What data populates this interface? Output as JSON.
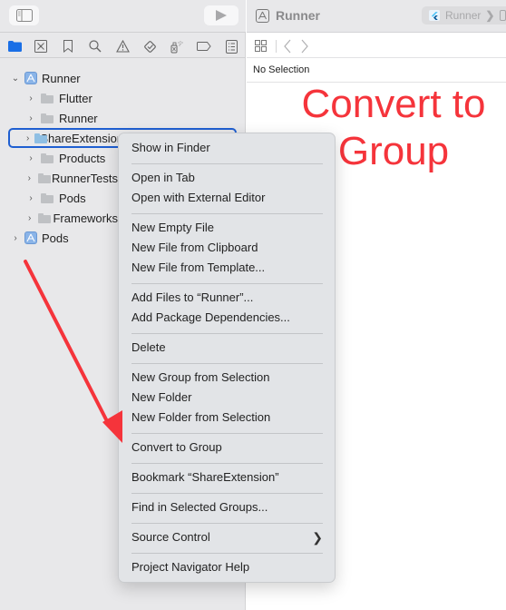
{
  "sidebar": {
    "toolbar": {
      "toggle_icon": "sidebar-toggle-icon",
      "run_icon": "play-icon"
    },
    "navigator_icons": [
      {
        "name": "project-navigator-icon",
        "active": true
      },
      {
        "name": "source-control-icon",
        "active": false
      },
      {
        "name": "bookmark-icon",
        "active": false
      },
      {
        "name": "search-icon",
        "active": false
      },
      {
        "name": "issue-warning-icon",
        "active": false
      },
      {
        "name": "test-navigator-icon",
        "active": false
      },
      {
        "name": "debug-spray-icon",
        "active": false
      },
      {
        "name": "breakpoint-icon",
        "active": false
      },
      {
        "name": "report-icon",
        "active": false
      }
    ],
    "tree": [
      {
        "label": "Runner",
        "type": "project",
        "expanded": true
      },
      {
        "label": "Flutter",
        "type": "folder"
      },
      {
        "label": "Runner",
        "type": "folder"
      },
      {
        "label": "ShareExtension",
        "type": "folder",
        "selected": true
      },
      {
        "label": "Products",
        "type": "folder"
      },
      {
        "label": "RunnerTests",
        "type": "folder"
      },
      {
        "label": "Pods",
        "type": "folder"
      },
      {
        "label": "Frameworks",
        "type": "folder"
      },
      {
        "label": "Pods",
        "type": "project",
        "expanded": false
      }
    ]
  },
  "editor": {
    "title": "Runner",
    "scheme": "Runner",
    "no_selection": "No Selection"
  },
  "annotation": {
    "line1": "Convert to",
    "line2": "Group",
    "color": "#f5343b"
  },
  "context_menu": {
    "items": [
      {
        "label": "Show in Finder"
      },
      {
        "label": "Open in Tab"
      },
      {
        "label": "Open with External Editor"
      },
      {
        "label": "New Empty File"
      },
      {
        "label": "New File from Clipboard"
      },
      {
        "label": "New File from Template..."
      },
      {
        "label": "Add Files to “Runner”..."
      },
      {
        "label": "Add Package Dependencies..."
      },
      {
        "label": "Delete"
      },
      {
        "label": "New Group from Selection"
      },
      {
        "label": "New Folder"
      },
      {
        "label": "New Folder from Selection"
      },
      {
        "label": "Convert to Group"
      },
      {
        "label": "Bookmark “ShareExtension”"
      },
      {
        "label": "Find in Selected Groups..."
      },
      {
        "label": "Source Control",
        "submenu": true
      },
      {
        "label": "Project Navigator Help"
      }
    ]
  },
  "colors": {
    "accent": "#1f5fd1",
    "annotation_red": "#f5343b"
  }
}
